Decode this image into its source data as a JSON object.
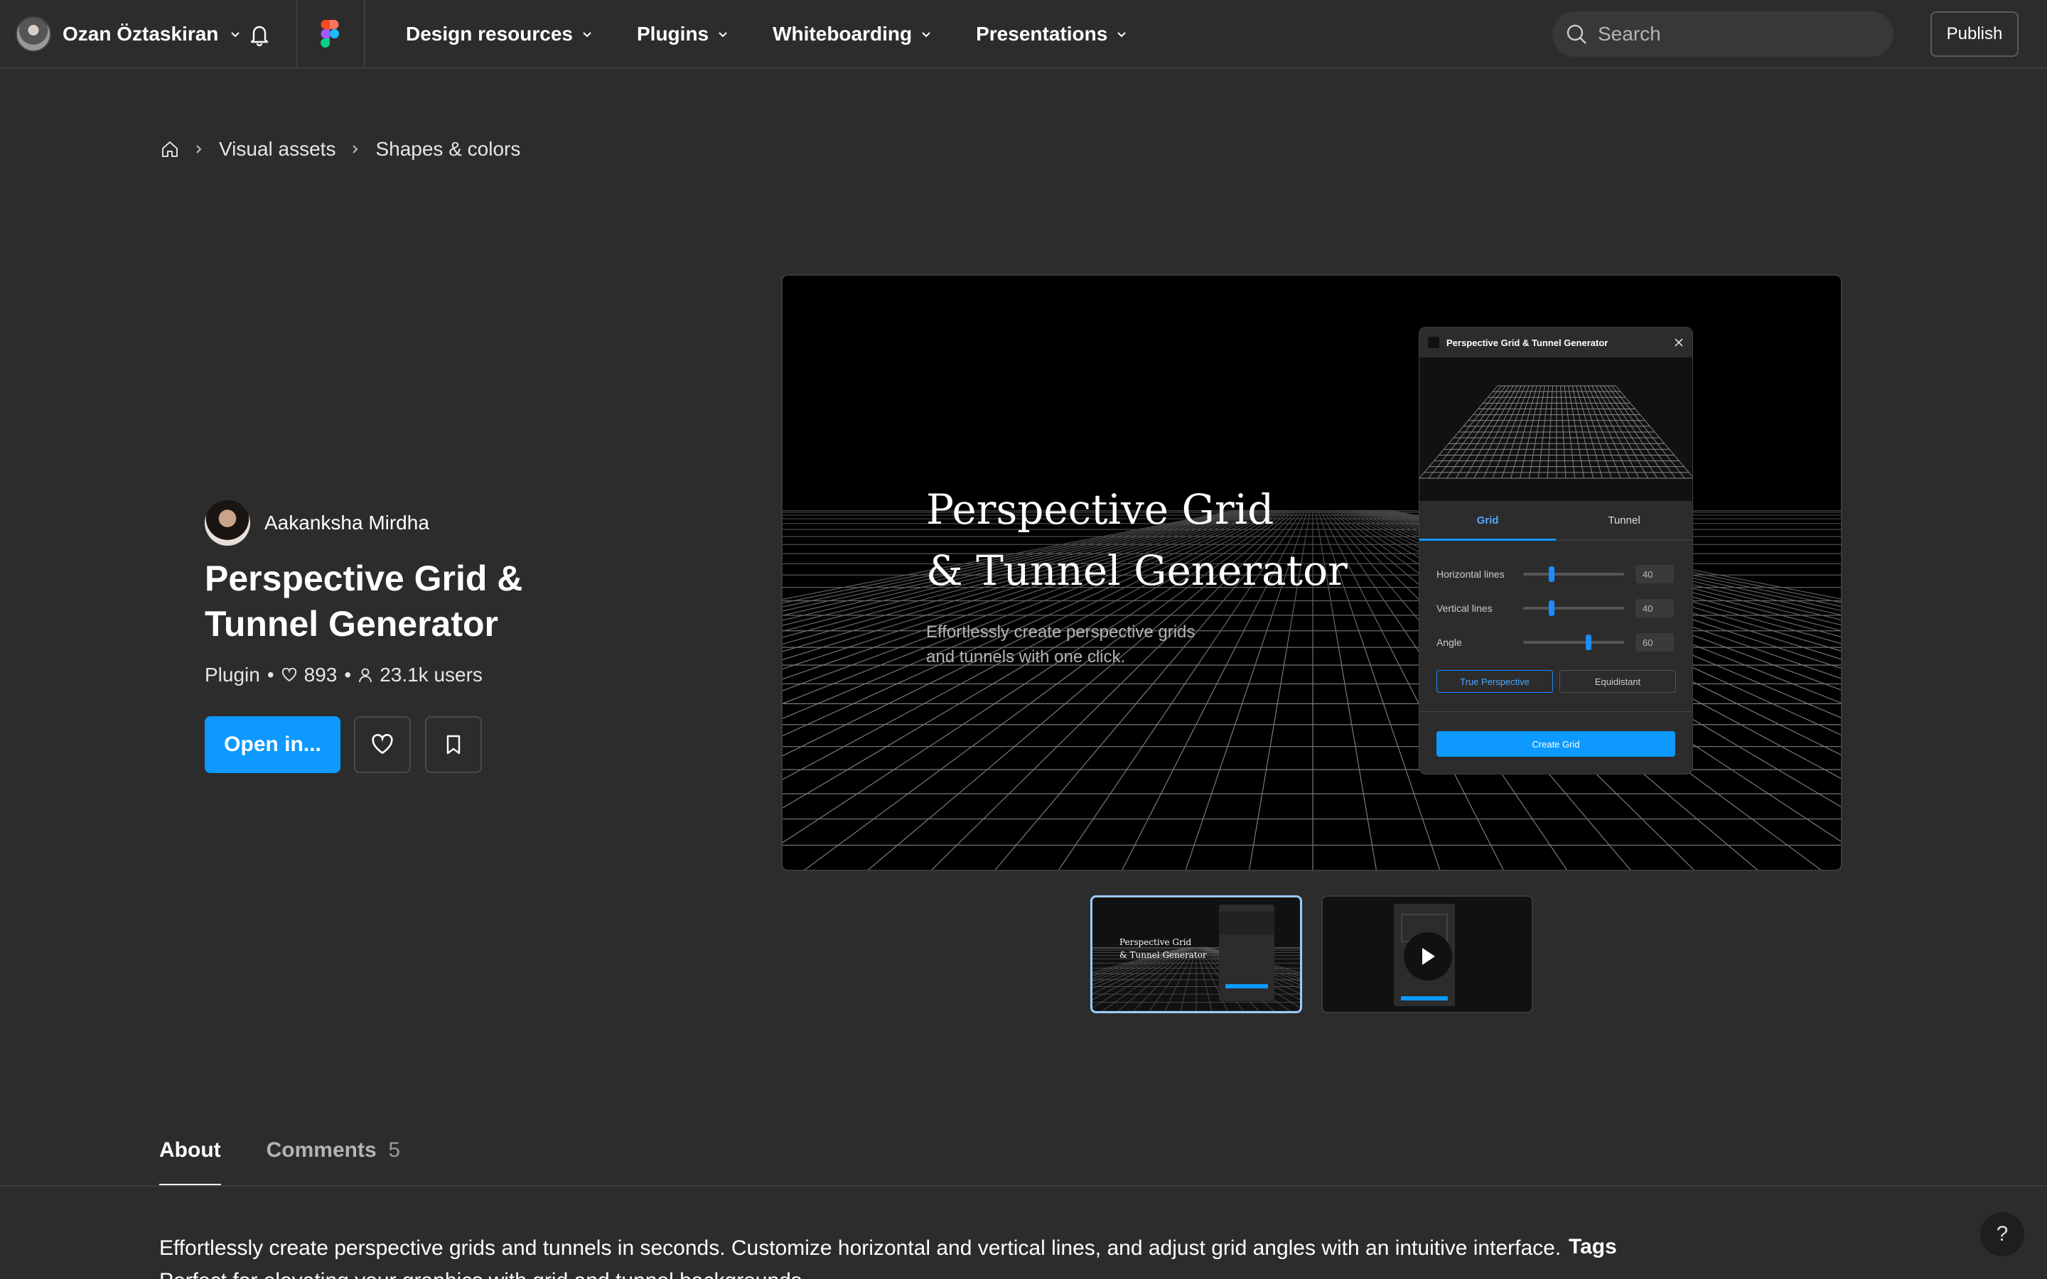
{
  "topbar": {
    "user_name": "Ozan Öztaskiran",
    "nav": [
      {
        "label": "Design resources"
      },
      {
        "label": "Plugins"
      },
      {
        "label": "Whiteboarding"
      },
      {
        "label": "Presentations"
      }
    ],
    "search_placeholder": "Search",
    "publish_label": "Publish"
  },
  "breadcrumb": [
    "Visual assets",
    "Shapes & colors"
  ],
  "plugin": {
    "author": "Aakanksha Mirdha",
    "title": "Perspective Grid & Tunnel Generator",
    "type": "Plugin",
    "likes": "893",
    "users": "23.1k users",
    "open_label": "Open in..."
  },
  "hero": {
    "title_line1": "Perspective Grid",
    "title_line2": "& Tunnel Generator",
    "subtitle_line1": "Effortlessly create perspective grids",
    "subtitle_line2": "and tunnels with one click.",
    "panel": {
      "title": "Perspective Grid & Tunnel Generator",
      "tabs": [
        "Grid",
        "Tunnel"
      ],
      "sliders": [
        {
          "label": "Horizontal lines",
          "value": "40",
          "level": 0.27
        },
        {
          "label": "Vertical lines",
          "value": "40",
          "level": 0.27
        },
        {
          "label": "Angle",
          "value": "60",
          "level": 0.66
        }
      ],
      "mode_options": [
        "True Perspective",
        "Equidistant"
      ],
      "create_label": "Create Grid"
    }
  },
  "thumbs": {
    "t1_line1": "Perspective Grid",
    "t1_line2": "& Tunnel Generator"
  },
  "tabs": {
    "about": "About",
    "comments": "Comments",
    "comments_count": "5"
  },
  "about_text": "Effortlessly create perspective grids and tunnels in seconds. Customize horizontal and vertical lines, and adjust grid angles with an intuitive interface. Perfect for elevating your graphics with grid and tunnel backgrounds.",
  "tags_heading": "Tags",
  "help_label": "?",
  "colors": {
    "accent": "#0d99ff",
    "background": "#2c2c2c"
  }
}
